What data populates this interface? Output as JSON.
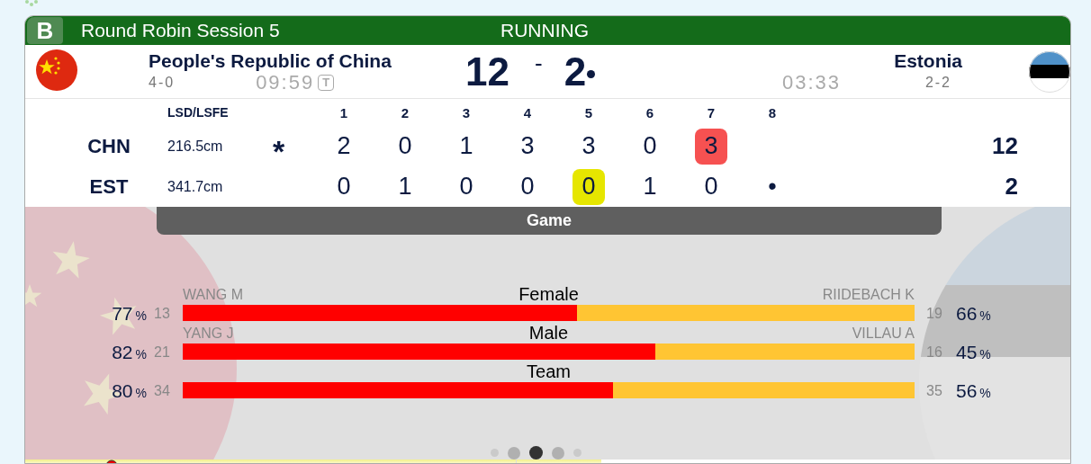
{
  "header": {
    "badge": "B",
    "title": "Round Robin Session 5",
    "status": "RUNNING"
  },
  "teams": [
    {
      "name": "People's Republic of China",
      "record": "4-0",
      "clock": "09:59",
      "timeout": "T",
      "score": "12",
      "hammer": false
    },
    {
      "name": "Estonia",
      "record": "2-2",
      "clock": "03:33",
      "score": "2",
      "hammer": true
    }
  ],
  "score_separator": "-",
  "linescore": {
    "lsd_heading": "LSD/LSFE",
    "ends": [
      "1",
      "2",
      "3",
      "4",
      "5",
      "6",
      "7",
      "8"
    ],
    "rows": [
      {
        "code": "CHN",
        "lsd": "216.5cm",
        "marker": "*",
        "ends": [
          {
            "value": "2"
          },
          {
            "value": "0"
          },
          {
            "value": "1"
          },
          {
            "value": "3"
          },
          {
            "value": "3"
          },
          {
            "value": "0"
          },
          {
            "value": "3",
            "color": "#f65151"
          }
        ],
        "total": "12"
      },
      {
        "code": "EST",
        "lsd": "341.7cm",
        "ends": [
          {
            "value": "0"
          },
          {
            "value": "1"
          },
          {
            "value": "0"
          },
          {
            "value": "0"
          },
          {
            "value": "0",
            "color": "#e6e600"
          },
          {
            "value": "1"
          },
          {
            "value": "0"
          },
          {
            "value": "•"
          }
        ],
        "total": "2"
      }
    ]
  },
  "stats": {
    "tab": "Game",
    "rows": [
      {
        "category": "Female",
        "level": 0.539,
        "home": {
          "player": "WANG M",
          "count": "13",
          "percent": "77",
          "unit": "%"
        },
        "away": {
          "player": "RIIDEBACH K",
          "count": "19",
          "percent": "66",
          "unit": "%"
        }
      },
      {
        "category": "Male",
        "level": 0.646,
        "home": {
          "player": "YANG J",
          "count": "21",
          "percent": "82",
          "unit": "%"
        },
        "away": {
          "player": "VILLAU A",
          "count": "16",
          "percent": "45",
          "unit": "%"
        }
      },
      {
        "category": "Team",
        "level": 0.588,
        "home": {
          "count": "34",
          "percent": "80",
          "unit": "%"
        },
        "away": {
          "count": "35",
          "percent": "56",
          "unit": "%"
        }
      }
    ]
  },
  "pager": [
    {
      "selected": false
    },
    {
      "selected": false
    },
    {
      "selected": true
    },
    {
      "selected": false
    },
    {
      "selected": false
    }
  ]
}
